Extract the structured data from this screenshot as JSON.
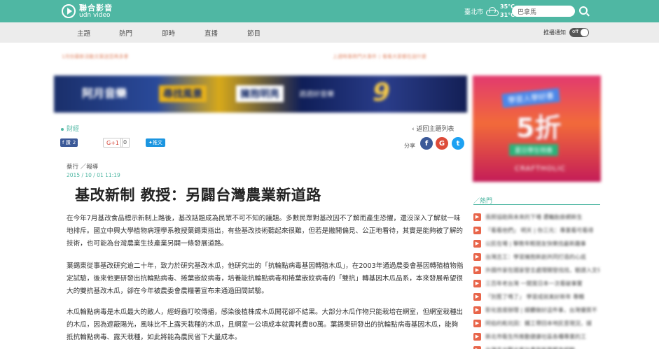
{
  "header": {
    "logo_name": "聯合影音",
    "logo_sub": "udn video",
    "city": "臺北市",
    "temp_high": "35°C",
    "temp_low": "31°C",
    "search_value": "巴拿馬",
    "brand_color": "#4fb7a3"
  },
  "nav": {
    "items": [
      "主題",
      "熱門",
      "即時",
      "直播",
      "節目"
    ],
    "notify_label": "推播通知",
    "toggle_label": "off"
  },
  "promo": {
    "left": "1月份最新活動文案送您再多拿",
    "right": "上週時事熱門大事件 ∣ 看看大家都在說什麼"
  },
  "banner_ad": {
    "t1": "阿月音樂",
    "t2": "尋找風景",
    "t3": "擁抱明亮",
    "t4": "週週好音樂",
    "t5": "9"
  },
  "side_ad": {
    "t1": "學習人學好書",
    "t2": "5折",
    "t3": "夏日學生特惠",
    "t4": "CRAFTHOLIC"
  },
  "article": {
    "category": "財經",
    "back_label": "返回主題列表",
    "fb_label": "f 讚",
    "fb_count": "2",
    "gplus_label": "G+1",
    "gplus_count": "0",
    "tweet_label": "推文",
    "share_label": "分享",
    "byline": "蔡行 ／報導",
    "date": "2015 / 10 / 01  11:19",
    "title": "基改新制 教授：另闢台灣農業新道路",
    "paragraphs": [
      "在今年7月基改食品標示新制上路後，基改話題成為民眾不可不知的議題。多數民眾對基改因不了解而產生恐懼，還沒深入了解就一味地排斥。國立中興大學植物病理學系教授葉錫東指出，有些基改技術聽起來很難，但若是撇開偏見、公正地看待，其實是能夠被了解的技術，也可能為台灣農業生技產業另闢一條發展道路。",
      "葉錫東從事基改研究逾二十年，致力於研究基改木瓜，他研究出的「抗輪點病毒基因轉殖木瓜」，在2003年通過農委會基因轉殖植物指定試驗，後來他更研發出抗輪點病毒、捲葉嵌紋病毒，培養能抗輪點病毒和捲葉嵌紋病毒的「雙抗」轉基因木瓜品系，本來發展希望很大的雙抗基改木瓜，卻在今年被農委會農糧署宣布未通過田間試驗。",
      "木瓜輪點病毒是木瓜最大的敵人，經蚜蟲叮咬傳播，感染後植株成木瓜開花卻不結果。大部分木瓜作物只能栽培在網室，但網室栽種出的木瓜，因為遮蔽陽光，風味比不上露天栽種的木瓜，且網室一公頃成本就需耗費80萬。葉錫東研發出的抗輪點病毒基因木瓜，能夠抵抗輪點病毒、露天栽種，如此將能為農民省下大量成本。"
    ]
  },
  "hot": {
    "title": "／熱門",
    "items": [
      "長照協助與未來的下場 遭輪胎掛網新生",
      "「看看他們」 明天 | 你三元：專業看可看得",
      "公民在場 | 擊敗年輕朋友快樂找最新趣事",
      "台灣志工：學習擁抱新創共同打造的心底",
      "外國作家在國家發言處理開發找找，驗證入文化",
      "三百年老台灣 一間賞日本一次看破事實",
      "「別惹了嗎了」 學習成就美好新年 專輯",
      "彰化首度辦理 | 媒體做好這件事，台灣優質不",
      "阿伯的乾坑田：鐵工帶回本地民意現況，媒",
      "新北市衛生所推動健康社區各種專業的工",
      "台灣走出觀光客計畫與新興都市經驗"
    ]
  }
}
